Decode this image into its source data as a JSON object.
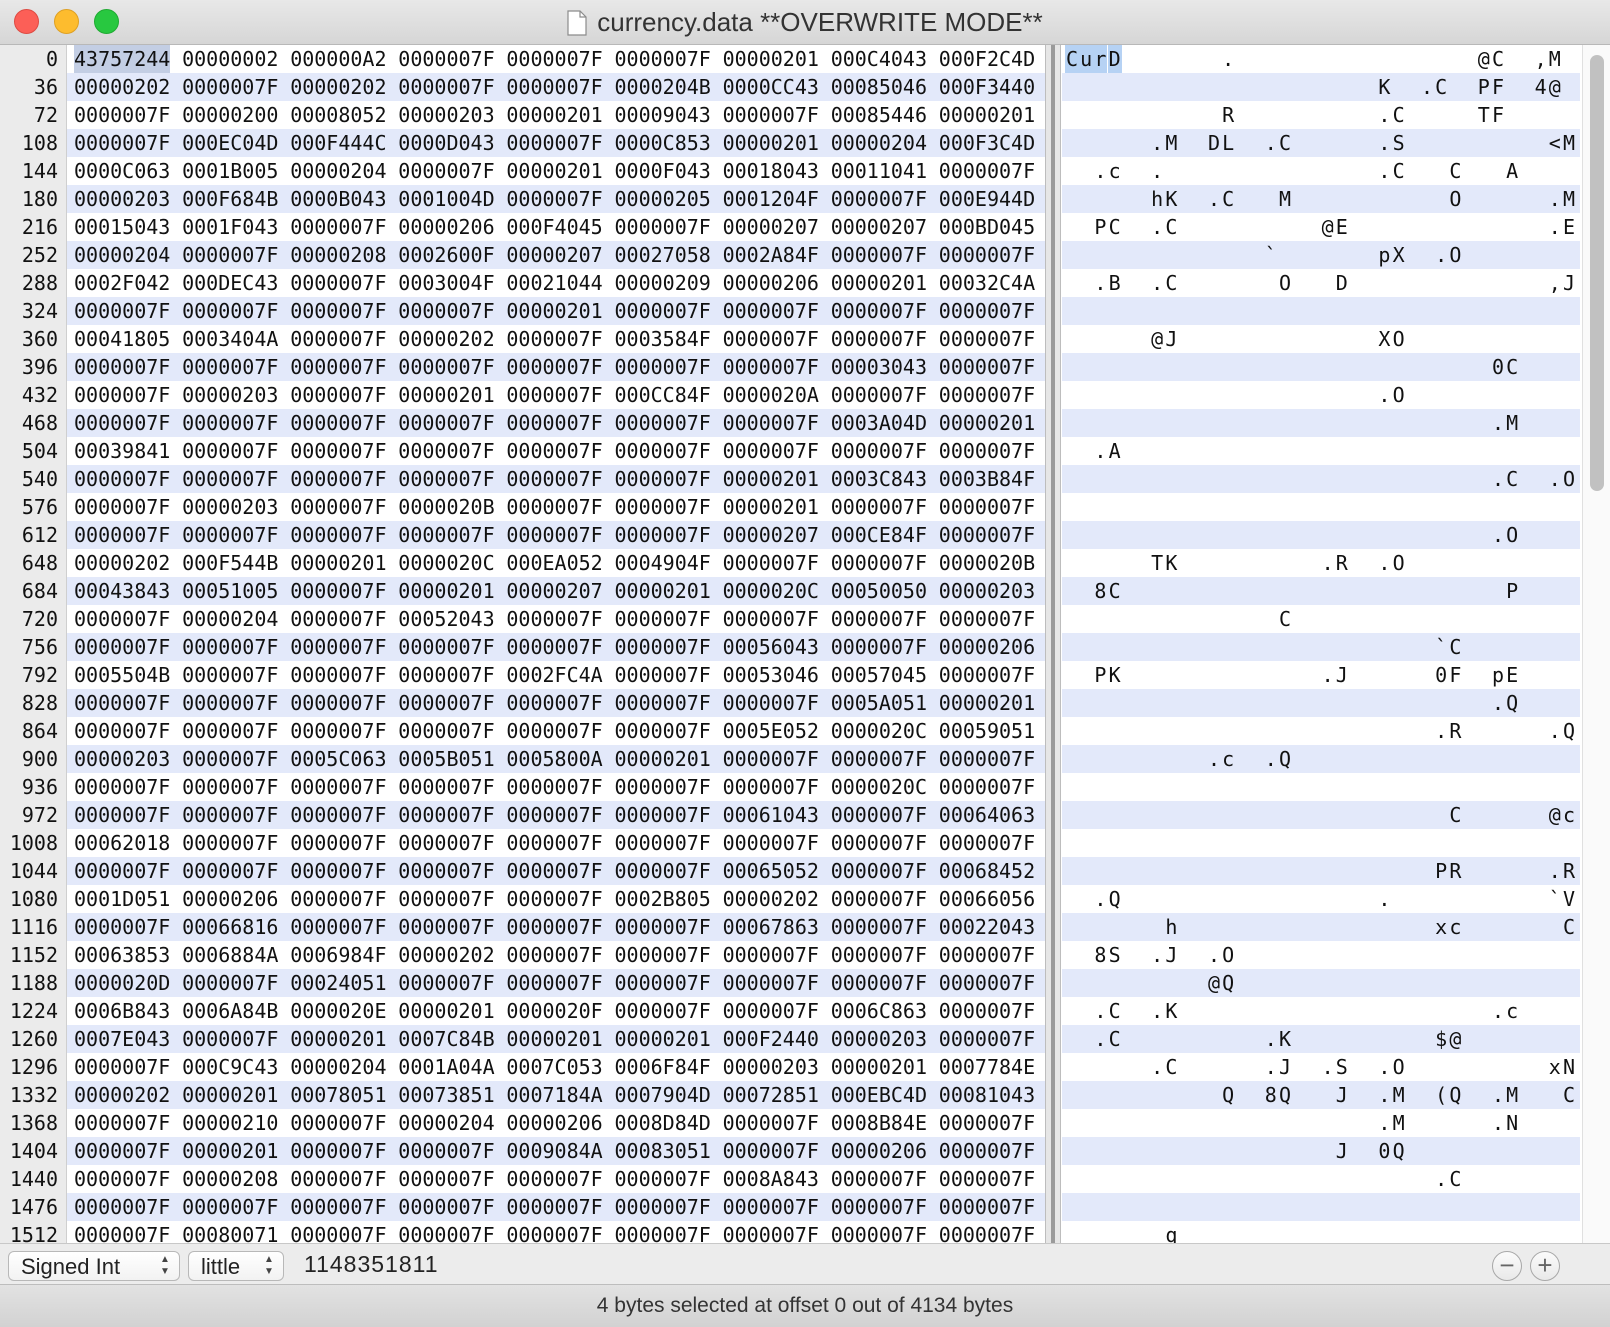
{
  "window": {
    "title": "currency.data **OVERWRITE MODE**"
  },
  "offsets": [
    "0",
    "36",
    "72",
    "108",
    "144",
    "180",
    "216",
    "252",
    "288",
    "324",
    "360",
    "396",
    "432",
    "468",
    "504",
    "540",
    "576",
    "612",
    "648",
    "684",
    "720",
    "756",
    "792",
    "828",
    "864",
    "900",
    "936",
    "972",
    "1008",
    "1044",
    "1080",
    "1116",
    "1152",
    "1188",
    "1224",
    "1260",
    "1296",
    "1332",
    "1368",
    "1404",
    "1440",
    "1476",
    "1512"
  ],
  "hex_rows": [
    [
      "43757244",
      "00000002",
      "000000A2",
      "0000007F",
      "0000007F",
      "0000007F",
      "00000201",
      "000C4043",
      "000F2C4D"
    ],
    [
      "00000202",
      "0000007F",
      "00000202",
      "0000007F",
      "0000007F",
      "0000204B",
      "0000CC43",
      "00085046",
      "000F3440"
    ],
    [
      "0000007F",
      "00000200",
      "00008052",
      "00000203",
      "00000201",
      "00009043",
      "0000007F",
      "00085446",
      "00000201"
    ],
    [
      "0000007F",
      "000EC04D",
      "000F444C",
      "0000D043",
      "0000007F",
      "0000C853",
      "00000201",
      "00000204",
      "000F3C4D"
    ],
    [
      "0000C063",
      "0001B005",
      "00000204",
      "0000007F",
      "00000201",
      "0000F043",
      "00018043",
      "00011041",
      "0000007F"
    ],
    [
      "00000203",
      "000F684B",
      "0000B043",
      "0001004D",
      "0000007F",
      "00000205",
      "0001204F",
      "0000007F",
      "000E944D"
    ],
    [
      "00015043",
      "0001F043",
      "0000007F",
      "00000206",
      "000F4045",
      "0000007F",
      "00000207",
      "00000207",
      "000BD045"
    ],
    [
      "00000204",
      "0000007F",
      "00000208",
      "0002600F",
      "00000207",
      "00027058",
      "0002A84F",
      "0000007F",
      "0000007F"
    ],
    [
      "0002F042",
      "000DEC43",
      "0000007F",
      "0003004F",
      "00021044",
      "00000209",
      "00000206",
      "00000201",
      "00032C4A"
    ],
    [
      "0000007F",
      "0000007F",
      "0000007F",
      "0000007F",
      "00000201",
      "0000007F",
      "0000007F",
      "0000007F",
      "0000007F"
    ],
    [
      "00041805",
      "0003404A",
      "0000007F",
      "00000202",
      "0000007F",
      "0003584F",
      "0000007F",
      "0000007F",
      "0000007F"
    ],
    [
      "0000007F",
      "0000007F",
      "0000007F",
      "0000007F",
      "0000007F",
      "0000007F",
      "0000007F",
      "00003043",
      "0000007F"
    ],
    [
      "0000007F",
      "00000203",
      "0000007F",
      "00000201",
      "0000007F",
      "000CC84F",
      "0000020A",
      "0000007F",
      "0000007F"
    ],
    [
      "0000007F",
      "0000007F",
      "0000007F",
      "0000007F",
      "0000007F",
      "0000007F",
      "0000007F",
      "0003A04D",
      "00000201"
    ],
    [
      "00039841",
      "0000007F",
      "0000007F",
      "0000007F",
      "0000007F",
      "0000007F",
      "0000007F",
      "0000007F",
      "0000007F"
    ],
    [
      "0000007F",
      "0000007F",
      "0000007F",
      "0000007F",
      "0000007F",
      "0000007F",
      "00000201",
      "0003C843",
      "0003B84F"
    ],
    [
      "0000007F",
      "00000203",
      "0000007F",
      "0000020B",
      "0000007F",
      "0000007F",
      "00000201",
      "0000007F",
      "0000007F"
    ],
    [
      "0000007F",
      "0000007F",
      "0000007F",
      "0000007F",
      "0000007F",
      "0000007F",
      "00000207",
      "000CE84F",
      "0000007F"
    ],
    [
      "00000202",
      "000F544B",
      "00000201",
      "0000020C",
      "000EA052",
      "0004904F",
      "0000007F",
      "0000007F",
      "0000020B"
    ],
    [
      "00043843",
      "00051005",
      "0000007F",
      "00000201",
      "00000207",
      "00000201",
      "0000020C",
      "00050050",
      "00000203"
    ],
    [
      "0000007F",
      "00000204",
      "0000007F",
      "00052043",
      "0000007F",
      "0000007F",
      "0000007F",
      "0000007F",
      "0000007F"
    ],
    [
      "0000007F",
      "0000007F",
      "0000007F",
      "0000007F",
      "0000007F",
      "0000007F",
      "00056043",
      "0000007F",
      "00000206"
    ],
    [
      "0005504B",
      "0000007F",
      "0000007F",
      "0000007F",
      "0002FC4A",
      "0000007F",
      "00053046",
      "00057045",
      "0000007F"
    ],
    [
      "0000007F",
      "0000007F",
      "0000007F",
      "0000007F",
      "0000007F",
      "0000007F",
      "0000007F",
      "0005A051",
      "00000201"
    ],
    [
      "0000007F",
      "0000007F",
      "0000007F",
      "0000007F",
      "0000007F",
      "0000007F",
      "0005E052",
      "0000020C",
      "00059051"
    ],
    [
      "00000203",
      "0000007F",
      "0005C063",
      "0005B051",
      "0005800A",
      "00000201",
      "0000007F",
      "0000007F",
      "0000007F"
    ],
    [
      "0000007F",
      "0000007F",
      "0000007F",
      "0000007F",
      "0000007F",
      "0000007F",
      "0000007F",
      "0000020C",
      "0000007F"
    ],
    [
      "0000007F",
      "0000007F",
      "0000007F",
      "0000007F",
      "0000007F",
      "0000007F",
      "00061043",
      "0000007F",
      "00064063"
    ],
    [
      "00062018",
      "0000007F",
      "0000007F",
      "0000007F",
      "0000007F",
      "0000007F",
      "0000007F",
      "0000007F",
      "0000007F"
    ],
    [
      "0000007F",
      "0000007F",
      "0000007F",
      "0000007F",
      "0000007F",
      "0000007F",
      "00065052",
      "0000007F",
      "00068452"
    ],
    [
      "0001D051",
      "00000206",
      "0000007F",
      "0000007F",
      "0000007F",
      "0002B805",
      "00000202",
      "0000007F",
      "00066056"
    ],
    [
      "0000007F",
      "00066816",
      "0000007F",
      "0000007F",
      "0000007F",
      "0000007F",
      "00067863",
      "0000007F",
      "00022043"
    ],
    [
      "00063853",
      "0006884A",
      "0006984F",
      "00000202",
      "0000007F",
      "0000007F",
      "0000007F",
      "0000007F",
      "0000007F"
    ],
    [
      "0000020D",
      "0000007F",
      "00024051",
      "0000007F",
      "0000007F",
      "0000007F",
      "0000007F",
      "0000007F",
      "0000007F"
    ],
    [
      "0006B843",
      "0006A84B",
      "0000020E",
      "00000201",
      "0000020F",
      "0000007F",
      "0000007F",
      "0006C863",
      "0000007F"
    ],
    [
      "0007E043",
      "0000007F",
      "00000201",
      "0007C84B",
      "00000201",
      "00000201",
      "000F2440",
      "00000203",
      "0000007F"
    ],
    [
      "0000007F",
      "000C9C43",
      "00000204",
      "0001A04A",
      "0007C053",
      "0006F84F",
      "00000203",
      "00000201",
      "0007784E"
    ],
    [
      "00000202",
      "00000201",
      "00078051",
      "00073851",
      "0007184A",
      "0007904D",
      "00072851",
      "000EBC4D",
      "00081043"
    ],
    [
      "0000007F",
      "00000210",
      "0000007F",
      "00000204",
      "00000206",
      "0008D84D",
      "0000007F",
      "0008B84E",
      "0000007F"
    ],
    [
      "0000007F",
      "00000201",
      "0000007F",
      "0000007F",
      "0009084A",
      "00083051",
      "0000007F",
      "00000206",
      "0000007F"
    ],
    [
      "0000007F",
      "00000208",
      "0000007F",
      "0000007F",
      "0000007F",
      "0000007F",
      "0008A843",
      "0000007F",
      "0000007F"
    ],
    [
      "0000007F",
      "0000007F",
      "0000007F",
      "0000007F",
      "0000007F",
      "0000007F",
      "0000007F",
      "0000007F",
      "0000007F"
    ],
    [
      "0000007F",
      "00080071",
      "0000007F",
      "0000007F",
      "0000007F",
      "0000007F",
      "0000007F",
      "0000007F",
      "0000007F"
    ]
  ],
  "ascii_rows": [
    [
      [
        0,
        "C"
      ],
      [
        1,
        "u"
      ],
      [
        2,
        "r"
      ],
      [
        3,
        "D"
      ],
      [
        11,
        "."
      ],
      [
        29,
        "@"
      ],
      [
        30,
        "C"
      ],
      [
        33,
        ","
      ],
      [
        34,
        "M"
      ]
    ],
    [
      [
        22,
        "K"
      ],
      [
        25,
        "."
      ],
      [
        26,
        "C"
      ],
      [
        29,
        "P"
      ],
      [
        30,
        "F"
      ],
      [
        33,
        "4"
      ],
      [
        34,
        "@"
      ]
    ],
    [
      [
        11,
        "R"
      ],
      [
        22,
        "."
      ],
      [
        23,
        "C"
      ],
      [
        29,
        "T"
      ],
      [
        30,
        "F"
      ]
    ],
    [
      [
        6,
        "."
      ],
      [
        7,
        "M"
      ],
      [
        10,
        "D"
      ],
      [
        11,
        "L"
      ],
      [
        14,
        "."
      ],
      [
        15,
        "C"
      ],
      [
        22,
        "."
      ],
      [
        23,
        "S"
      ],
      [
        34,
        "<"
      ],
      [
        35,
        "M"
      ]
    ],
    [
      [
        2,
        "."
      ],
      [
        3,
        "c"
      ],
      [
        6,
        "."
      ],
      [
        22,
        "."
      ],
      [
        23,
        "C"
      ],
      [
        27,
        "C"
      ],
      [
        31,
        "A"
      ]
    ],
    [
      [
        6,
        "h"
      ],
      [
        7,
        "K"
      ],
      [
        10,
        "."
      ],
      [
        11,
        "C"
      ],
      [
        15,
        "M"
      ],
      [
        27,
        "O"
      ],
      [
        34,
        "."
      ],
      [
        35,
        "M"
      ]
    ],
    [
      [
        2,
        "P"
      ],
      [
        3,
        "C"
      ],
      [
        6,
        "."
      ],
      [
        7,
        "C"
      ],
      [
        18,
        "@"
      ],
      [
        19,
        "E"
      ],
      [
        34,
        "."
      ],
      [
        35,
        "E"
      ]
    ],
    [
      [
        14,
        "`"
      ],
      [
        22,
        "p"
      ],
      [
        23,
        "X"
      ],
      [
        26,
        "."
      ],
      [
        27,
        "O"
      ]
    ],
    [
      [
        2,
        "."
      ],
      [
        3,
        "B"
      ],
      [
        6,
        "."
      ],
      [
        7,
        "C"
      ],
      [
        15,
        "O"
      ],
      [
        19,
        "D"
      ],
      [
        34,
        ","
      ],
      [
        35,
        "J"
      ]
    ],
    [],
    [
      [
        6,
        "@"
      ],
      [
        7,
        "J"
      ],
      [
        22,
        "X"
      ],
      [
        23,
        "O"
      ]
    ],
    [
      [
        30,
        "0"
      ],
      [
        31,
        "C"
      ]
    ],
    [
      [
        22,
        "."
      ],
      [
        23,
        "O"
      ]
    ],
    [
      [
        30,
        "."
      ],
      [
        31,
        "M"
      ]
    ],
    [
      [
        2,
        "."
      ],
      [
        3,
        "A"
      ]
    ],
    [
      [
        30,
        "."
      ],
      [
        31,
        "C"
      ],
      [
        34,
        "."
      ],
      [
        35,
        "O"
      ]
    ],
    [],
    [
      [
        30,
        "."
      ],
      [
        31,
        "O"
      ]
    ],
    [
      [
        6,
        "T"
      ],
      [
        7,
        "K"
      ],
      [
        18,
        "."
      ],
      [
        19,
        "R"
      ],
      [
        22,
        "."
      ],
      [
        23,
        "O"
      ]
    ],
    [
      [
        2,
        "8"
      ],
      [
        3,
        "C"
      ],
      [
        31,
        "P"
      ]
    ],
    [
      [
        15,
        "C"
      ]
    ],
    [
      [
        26,
        "`"
      ],
      [
        27,
        "C"
      ]
    ],
    [
      [
        2,
        "P"
      ],
      [
        3,
        "K"
      ],
      [
        18,
        "."
      ],
      [
        19,
        "J"
      ],
      [
        26,
        "0"
      ],
      [
        27,
        "F"
      ],
      [
        30,
        "p"
      ],
      [
        31,
        "E"
      ]
    ],
    [
      [
        30,
        "."
      ],
      [
        31,
        "Q"
      ]
    ],
    [
      [
        26,
        "."
      ],
      [
        27,
        "R"
      ],
      [
        34,
        "."
      ],
      [
        35,
        "Q"
      ]
    ],
    [
      [
        10,
        "."
      ],
      [
        11,
        "c"
      ],
      [
        14,
        "."
      ],
      [
        15,
        "Q"
      ]
    ],
    [],
    [
      [
        27,
        "C"
      ],
      [
        34,
        "@"
      ],
      [
        35,
        "c"
      ]
    ],
    [],
    [
      [
        26,
        "P"
      ],
      [
        27,
        "R"
      ],
      [
        34,
        "."
      ],
      [
        35,
        "R"
      ]
    ],
    [
      [
        2,
        "."
      ],
      [
        3,
        "Q"
      ],
      [
        22,
        "."
      ],
      [
        34,
        "`"
      ],
      [
        35,
        "V"
      ]
    ],
    [
      [
        7,
        "h"
      ],
      [
        26,
        "x"
      ],
      [
        27,
        "c"
      ],
      [
        35,
        "C"
      ]
    ],
    [
      [
        2,
        "8"
      ],
      [
        3,
        "S"
      ],
      [
        6,
        "."
      ],
      [
        7,
        "J"
      ],
      [
        10,
        "."
      ],
      [
        11,
        "O"
      ]
    ],
    [
      [
        10,
        "@"
      ],
      [
        11,
        "Q"
      ]
    ],
    [
      [
        2,
        "."
      ],
      [
        3,
        "C"
      ],
      [
        6,
        "."
      ],
      [
        7,
        "K"
      ],
      [
        30,
        "."
      ],
      [
        31,
        "c"
      ]
    ],
    [
      [
        2,
        "."
      ],
      [
        3,
        "C"
      ],
      [
        14,
        "."
      ],
      [
        15,
        "K"
      ],
      [
        26,
        "$"
      ],
      [
        27,
        "@"
      ]
    ],
    [
      [
        6,
        "."
      ],
      [
        7,
        "C"
      ],
      [
        14,
        "."
      ],
      [
        15,
        "J"
      ],
      [
        18,
        "."
      ],
      [
        19,
        "S"
      ],
      [
        22,
        "."
      ],
      [
        23,
        "O"
      ],
      [
        34,
        "x"
      ],
      [
        35,
        "N"
      ]
    ],
    [
      [
        11,
        "Q"
      ],
      [
        14,
        "8"
      ],
      [
        15,
        "Q"
      ],
      [
        19,
        "J"
      ],
      [
        22,
        "."
      ],
      [
        23,
        "M"
      ],
      [
        26,
        "("
      ],
      [
        27,
        "Q"
      ],
      [
        30,
        "."
      ],
      [
        31,
        "M"
      ],
      [
        35,
        "C"
      ]
    ],
    [
      [
        22,
        "."
      ],
      [
        23,
        "M"
      ],
      [
        30,
        "."
      ],
      [
        31,
        "N"
      ]
    ],
    [
      [
        19,
        "J"
      ],
      [
        22,
        "0"
      ],
      [
        23,
        "Q"
      ]
    ],
    [
      [
        26,
        "."
      ],
      [
        27,
        "C"
      ]
    ],
    [],
    [
      [
        7,
        "q"
      ]
    ]
  ],
  "bottom": {
    "type_select": "Signed Int",
    "endian_select": "little",
    "value": "1148351811",
    "minus_label": "−",
    "plus_label": "+"
  },
  "status": "4 bytes selected at offset 0 out of 4134 bytes",
  "colors": {
    "stripe": "#e3e9fa",
    "selection": "#c3cee4",
    "gutter": "#ebebeb"
  }
}
